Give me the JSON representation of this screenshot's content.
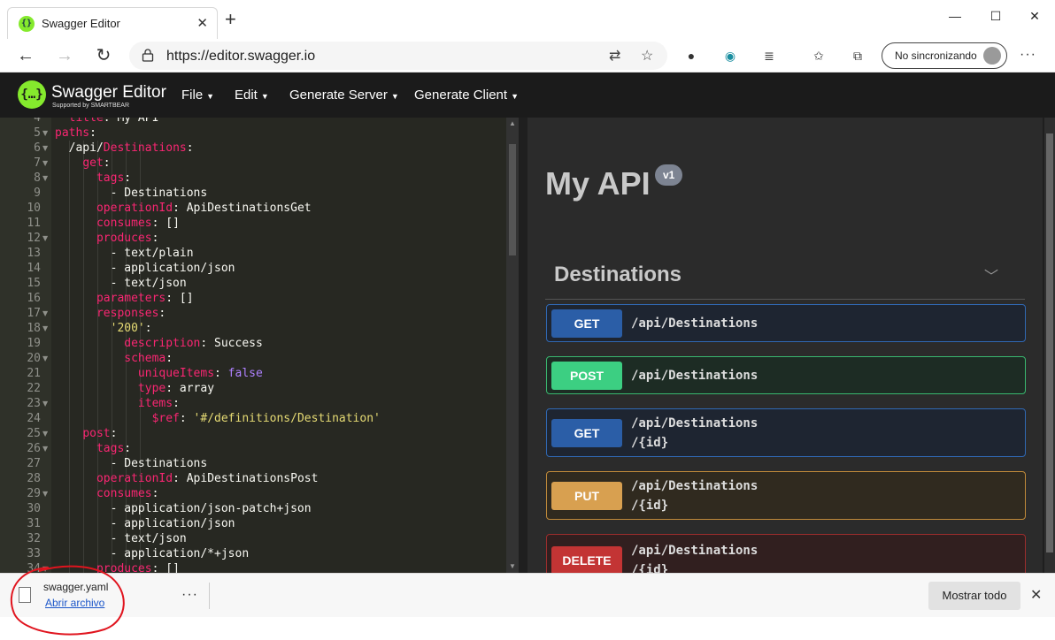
{
  "browser": {
    "tab_title": "Swagger Editor",
    "url": "https://editor.swagger.io",
    "profile_label": "No sincronizando"
  },
  "swagger": {
    "logo_title": "Swagger Editor",
    "logo_sub": "Supported by SMARTBEAR",
    "menus": [
      "File",
      "Edit",
      "Generate Server",
      "Generate Client"
    ]
  },
  "editor": {
    "lines": [
      {
        "n": "4",
        "fold": false,
        "indent": 0,
        "parts": [
          [
            "k",
            "  title"
          ],
          [
            "v",
            ": My API"
          ]
        ]
      },
      {
        "n": "5",
        "fold": true,
        "indent": 0,
        "parts": [
          [
            "k",
            "paths"
          ],
          [
            "v",
            ":"
          ]
        ]
      },
      {
        "n": "6",
        "fold": true,
        "indent": 1,
        "parts": [
          [
            "v",
            "  /api/"
          ],
          [
            "k",
            "Destinations"
          ],
          [
            "v",
            ":"
          ]
        ]
      },
      {
        "n": "7",
        "fold": true,
        "indent": 2,
        "parts": [
          [
            "v",
            "    "
          ],
          [
            "k",
            "get"
          ],
          [
            "v",
            ":"
          ]
        ]
      },
      {
        "n": "8",
        "fold": true,
        "indent": 3,
        "parts": [
          [
            "v",
            "      "
          ],
          [
            "k",
            "tags"
          ],
          [
            "v",
            ":"
          ]
        ]
      },
      {
        "n": "9",
        "fold": false,
        "indent": 4,
        "parts": [
          [
            "v",
            "        - Destinations"
          ]
        ]
      },
      {
        "n": "10",
        "fold": false,
        "indent": 3,
        "parts": [
          [
            "v",
            "      "
          ],
          [
            "k",
            "operationId"
          ],
          [
            "v",
            ": ApiDestinationsGet"
          ]
        ]
      },
      {
        "n": "11",
        "fold": false,
        "indent": 3,
        "parts": [
          [
            "v",
            "      "
          ],
          [
            "k",
            "consumes"
          ],
          [
            "v",
            ": []"
          ]
        ]
      },
      {
        "n": "12",
        "fold": true,
        "indent": 3,
        "parts": [
          [
            "v",
            "      "
          ],
          [
            "k",
            "produces"
          ],
          [
            "v",
            ":"
          ]
        ]
      },
      {
        "n": "13",
        "fold": false,
        "indent": 4,
        "parts": [
          [
            "v",
            "        - text/plain"
          ]
        ]
      },
      {
        "n": "14",
        "fold": false,
        "indent": 4,
        "parts": [
          [
            "v",
            "        - application/json"
          ]
        ]
      },
      {
        "n": "15",
        "fold": false,
        "indent": 4,
        "parts": [
          [
            "v",
            "        - text/json"
          ]
        ]
      },
      {
        "n": "16",
        "fold": false,
        "indent": 3,
        "parts": [
          [
            "v",
            "      "
          ],
          [
            "k",
            "parameters"
          ],
          [
            "v",
            ": []"
          ]
        ]
      },
      {
        "n": "17",
        "fold": true,
        "indent": 3,
        "parts": [
          [
            "v",
            "      "
          ],
          [
            "k",
            "responses"
          ],
          [
            "v",
            ":"
          ]
        ]
      },
      {
        "n": "18",
        "fold": true,
        "indent": 4,
        "parts": [
          [
            "v",
            "        "
          ],
          [
            "s",
            "'200'"
          ],
          [
            "v",
            ":"
          ]
        ]
      },
      {
        "n": "19",
        "fold": false,
        "indent": 5,
        "parts": [
          [
            "v",
            "          "
          ],
          [
            "k",
            "description"
          ],
          [
            "v",
            ": Success"
          ]
        ]
      },
      {
        "n": "20",
        "fold": true,
        "indent": 5,
        "parts": [
          [
            "v",
            "          "
          ],
          [
            "k",
            "schema"
          ],
          [
            "v",
            ":"
          ]
        ]
      },
      {
        "n": "21",
        "fold": false,
        "indent": 6,
        "parts": [
          [
            "v",
            "            "
          ],
          [
            "k",
            "uniqueItems"
          ],
          [
            "v",
            ": "
          ],
          [
            "c",
            "false"
          ]
        ]
      },
      {
        "n": "22",
        "fold": false,
        "indent": 6,
        "parts": [
          [
            "v",
            "            "
          ],
          [
            "k",
            "type"
          ],
          [
            "v",
            ": array"
          ]
        ]
      },
      {
        "n": "23",
        "fold": true,
        "indent": 6,
        "parts": [
          [
            "v",
            "            "
          ],
          [
            "k",
            "items"
          ],
          [
            "v",
            ":"
          ]
        ]
      },
      {
        "n": "24",
        "fold": false,
        "indent": 7,
        "parts": [
          [
            "v",
            "              "
          ],
          [
            "k",
            "$ref"
          ],
          [
            "v",
            ": "
          ],
          [
            "s",
            "'#/definitions/Destination'"
          ]
        ]
      },
      {
        "n": "25",
        "fold": true,
        "indent": 2,
        "parts": [
          [
            "v",
            "    "
          ],
          [
            "k",
            "post"
          ],
          [
            "v",
            ":"
          ]
        ]
      },
      {
        "n": "26",
        "fold": true,
        "indent": 3,
        "parts": [
          [
            "v",
            "      "
          ],
          [
            "k",
            "tags"
          ],
          [
            "v",
            ":"
          ]
        ]
      },
      {
        "n": "27",
        "fold": false,
        "indent": 4,
        "parts": [
          [
            "v",
            "        - Destinations"
          ]
        ]
      },
      {
        "n": "28",
        "fold": false,
        "indent": 3,
        "parts": [
          [
            "v",
            "      "
          ],
          [
            "k",
            "operationId"
          ],
          [
            "v",
            ": ApiDestinationsPost"
          ]
        ]
      },
      {
        "n": "29",
        "fold": true,
        "indent": 3,
        "parts": [
          [
            "v",
            "      "
          ],
          [
            "k",
            "consumes"
          ],
          [
            "v",
            ":"
          ]
        ]
      },
      {
        "n": "30",
        "fold": false,
        "indent": 4,
        "parts": [
          [
            "v",
            "        - application/json-patch+json"
          ]
        ]
      },
      {
        "n": "31",
        "fold": false,
        "indent": 4,
        "parts": [
          [
            "v",
            "        - application/json"
          ]
        ]
      },
      {
        "n": "32",
        "fold": false,
        "indent": 4,
        "parts": [
          [
            "v",
            "        - text/json"
          ]
        ]
      },
      {
        "n": "33",
        "fold": false,
        "indent": 4,
        "parts": [
          [
            "v",
            "        - application/*+json"
          ]
        ]
      },
      {
        "n": "34",
        "fold": true,
        "indent": 3,
        "parts": [
          [
            "v",
            "      "
          ],
          [
            "k",
            "produces"
          ],
          [
            "v",
            ": []"
          ]
        ]
      }
    ]
  },
  "preview": {
    "title": "My API",
    "version": "v1",
    "tag": "Destinations",
    "operations": [
      {
        "method": "GET",
        "path_lines": [
          "/api/Destinations"
        ],
        "color": "#2b5ea7",
        "bg": "#1e2531",
        "border": "#3068b3"
      },
      {
        "method": "POST",
        "path_lines": [
          "/api/Destinations"
        ],
        "color": "#3ccf82",
        "bg": "#1d2c24",
        "border": "#39b86f"
      },
      {
        "method": "GET",
        "path_lines": [
          "/api/Destinations",
          "/{id}"
        ],
        "color": "#2b5ea7",
        "bg": "#1e2531",
        "border": "#3068b3"
      },
      {
        "method": "PUT",
        "path_lines": [
          "/api/Destinations",
          "/{id}"
        ],
        "color": "#d8a050",
        "bg": "#302a1f",
        "border": "#c08a3a"
      },
      {
        "method": "DELETE",
        "path_lines": [
          "/api/Destinations",
          "/{id}"
        ],
        "color": "#c33434",
        "bg": "#311f1f",
        "border": "#9c2d2d"
      }
    ]
  },
  "download": {
    "filename": "swagger.yaml",
    "open_label": "Abrir archivo",
    "show_all": "Mostrar todo"
  }
}
